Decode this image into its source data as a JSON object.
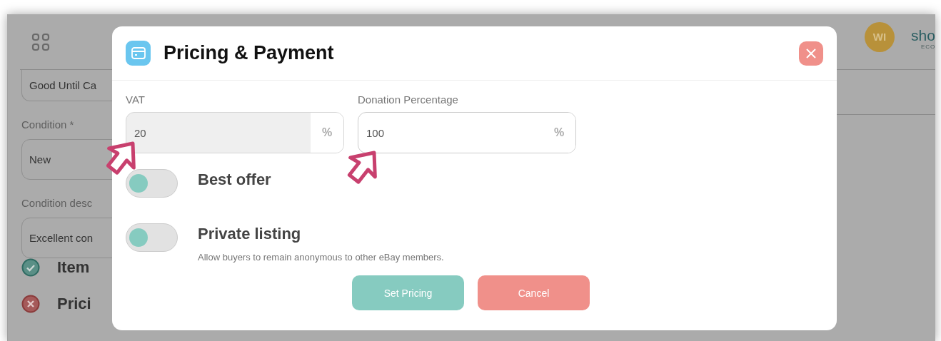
{
  "background": {
    "header": {
      "avatar": {
        "initials": "WI"
      },
      "logo": {
        "text": "sho",
        "subtext": "ECO"
      }
    },
    "left_panel": {
      "fields": [
        {
          "value": "Good Until Ca"
        },
        {
          "label": "Condition *",
          "value": "New"
        },
        {
          "label": "Condition desc",
          "value": "Excellent con"
        }
      ],
      "sections": [
        {
          "title": "Item",
          "kind": "complete"
        },
        {
          "title": "Prici",
          "kind": "error"
        }
      ]
    }
  },
  "modal": {
    "title": "Pricing & Payment",
    "fields": [
      {
        "label": "VAT",
        "value": "20",
        "suffix": "%",
        "disabled": true
      },
      {
        "label": "Donation Percentage",
        "value": "100",
        "suffix": "%",
        "disabled": false
      }
    ],
    "toggles": [
      {
        "label": "Best offer",
        "checked": false
      },
      {
        "label": "Private listing",
        "description": "Allow buyers to remain anonymous to other eBay members.",
        "checked": false
      }
    ],
    "buttons": [
      {
        "label": "Set Pricing",
        "kind": "primary"
      },
      {
        "label": "Cancel",
        "kind": "danger"
      }
    ]
  }
}
